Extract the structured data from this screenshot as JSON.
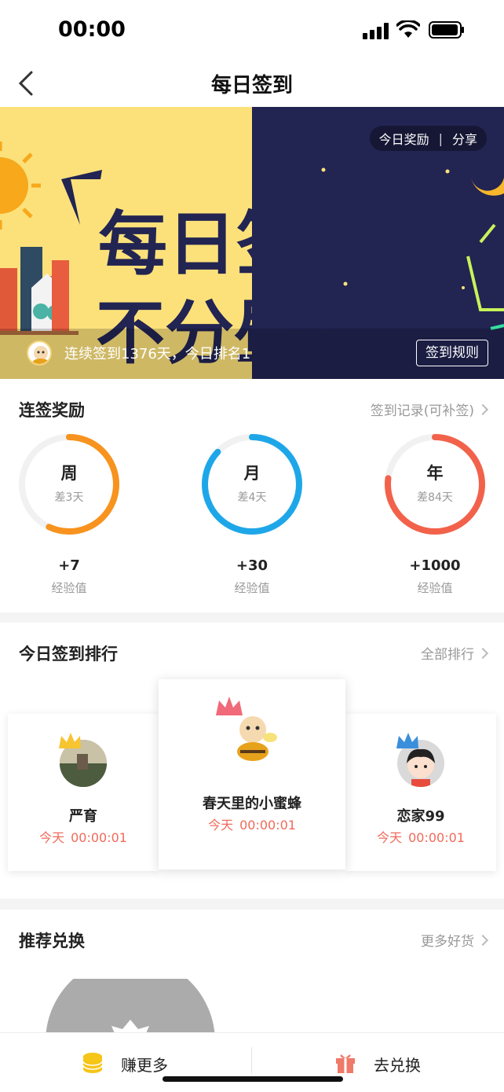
{
  "status_bar": {
    "time": "00:00"
  },
  "nav": {
    "title": "每日签到"
  },
  "banner": {
    "headline_line1": "每日签到",
    "headline_line2": "不分昼夜",
    "reward_link": "今日奖励",
    "separator": "|",
    "share_link": "分享",
    "streak_text": "连续签到1376天，今日排名1",
    "rules_button": "签到规则"
  },
  "streak_rewards": {
    "title": "连签奖励",
    "link": "签到记录(可补签)",
    "items": [
      {
        "label": "周",
        "remaining": "差3天",
        "reward": "+7",
        "unit": "经验值",
        "progress": 0.57,
        "color": "#f7931e"
      },
      {
        "label": "月",
        "remaining": "差4天",
        "reward": "+30",
        "unit": "经验值",
        "progress": 0.87,
        "color": "#1ea7e8"
      },
      {
        "label": "年",
        "remaining": "差84天",
        "reward": "+1000",
        "unit": "经验值",
        "progress": 0.77,
        "color": "#f2624a"
      }
    ]
  },
  "ranking": {
    "title": "今日签到排行",
    "link": "全部排行",
    "entries": [
      {
        "name": "严育",
        "day": "今天",
        "time": "00:00:01"
      },
      {
        "name": "春天里的小蜜蜂",
        "day": "今天",
        "time": "00:00:01"
      },
      {
        "name": "恋家99",
        "day": "今天",
        "time": "00:00:01"
      }
    ]
  },
  "exchange": {
    "title": "推荐兑换",
    "link": "更多好货"
  },
  "bottom_bar": {
    "earn_more": "赚更多",
    "go_exchange": "去兑换"
  },
  "colors": {
    "accent_red": "#f06a5a",
    "banner_yellow": "#fce17a",
    "banner_navy": "#222452"
  }
}
